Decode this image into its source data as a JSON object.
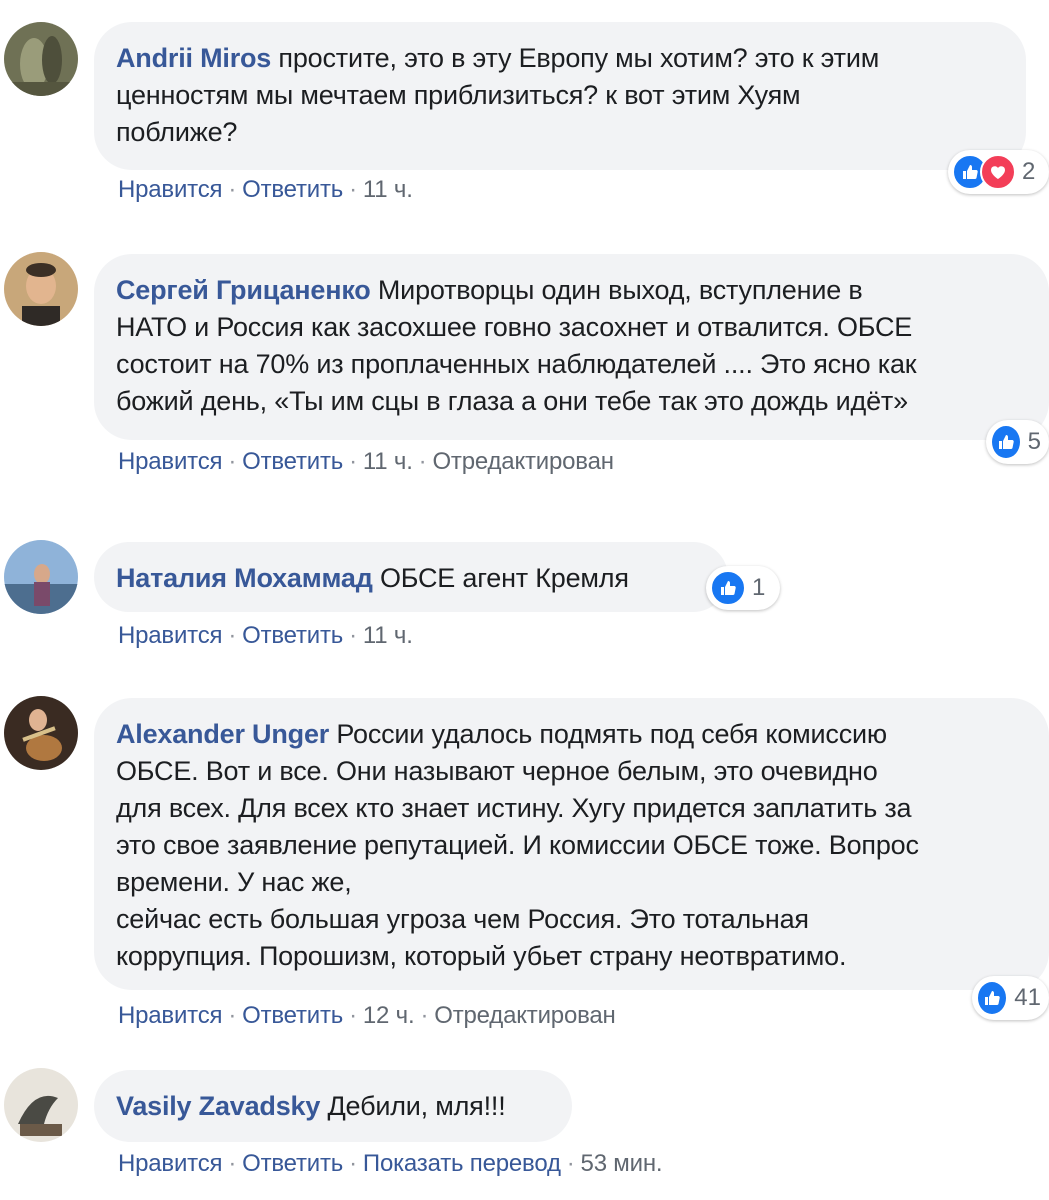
{
  "colors": {
    "author": "#385898",
    "link": "#385898",
    "bubble_bg": "#f2f3f5",
    "meta_gray": "#606770",
    "like_blue": "#1877f2",
    "love_red": "#f33e58"
  },
  "comments": [
    {
      "author": "Andrii Miros",
      "text": "простите, это в эту Европу мы хотим? это к этим\nценностям мы мечтаем приблизиться? к вот этим Хуям\nпоближе?",
      "actions": {
        "like": "Нравится",
        "reply": "Ответить",
        "time": "11 ч."
      },
      "reactions": {
        "icons": [
          "like-icon",
          "love-icon"
        ],
        "count": "2"
      }
    },
    {
      "author": "Сергей Грицаненко",
      "text": "Миротворцы один выход, вступление в\nНАТО и Россия как засохшее говно засохнет и отвалится. ОБСЕ\nсостоит на 70% из проплаченных наблюдателей .... Это ясно как\nбожий день, «Ты им сцы в глаза а они тебе так это дождь идёт»",
      "actions": {
        "like": "Нравится",
        "reply": "Ответить",
        "time": "11 ч.",
        "edited": "Отредактирован"
      },
      "reactions": {
        "icons": [
          "like-icon"
        ],
        "count": "5"
      }
    },
    {
      "author": "Наталия Мохаммад",
      "text": "ОБСЕ агент Кремля",
      "actions": {
        "like": "Нравится",
        "reply": "Ответить",
        "time": "11 ч."
      },
      "reactions": {
        "icons": [
          "like-icon"
        ],
        "count": "1"
      }
    },
    {
      "author": "Alexander Unger",
      "text": "России удалось подмять под себя комиссию\nОБСЕ. Вот и все. Они называют черное белым, это очевидно\nдля всех. Для всех кто знает истину. Хугу придется заплатить за\nэто свое заявление репутацией. И комиссии ОБСЕ тоже. Вопрос\nвремени. У нас же,\nсейчас есть большая угроза чем Россия. Это тотальная\nкоррупция. Порошизм, который убьет страну неотвратимо.",
      "actions": {
        "like": "Нравится",
        "reply": "Ответить",
        "time": "12 ч.",
        "edited": "Отредактирован"
      },
      "reactions": {
        "icons": [
          "like-icon"
        ],
        "count": "41"
      }
    },
    {
      "author": "Vasily Zavadsky",
      "text": "Дебили, мля!!!",
      "actions": {
        "like": "Нравится",
        "reply": "Ответить",
        "translate": "Показать перевод",
        "time": "53 мин."
      }
    }
  ]
}
